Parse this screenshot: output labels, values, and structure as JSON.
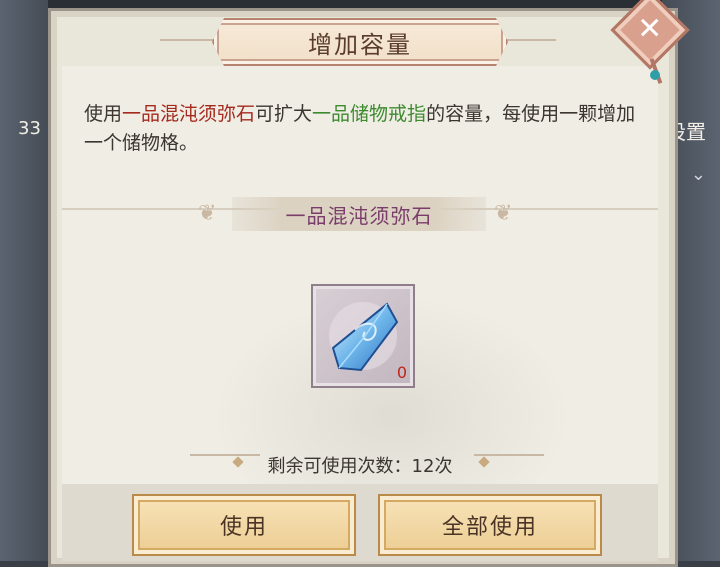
{
  "dialog": {
    "title": "增加容量",
    "description": {
      "part1": "使用",
      "item_name": "一品混沌须弥石",
      "part2": "可扩大",
      "target_name": "一品储物戒指",
      "part3": "的容量，每使用一颗增加一个储物格。"
    },
    "item_section_title": "一品混沌须弥石",
    "item_count": "0",
    "remaining_label": "剩余可使用次数：12次",
    "buttons": {
      "use": "使用",
      "use_all": "全部使用"
    },
    "close_icon": "close-icon"
  },
  "background": {
    "left_number": "33",
    "right_label": "设置"
  },
  "colors": {
    "item_name": "#a52a1e",
    "target_name": "#3d8a2f",
    "section_title": "#7a3c6a",
    "count": "#c0231a"
  }
}
